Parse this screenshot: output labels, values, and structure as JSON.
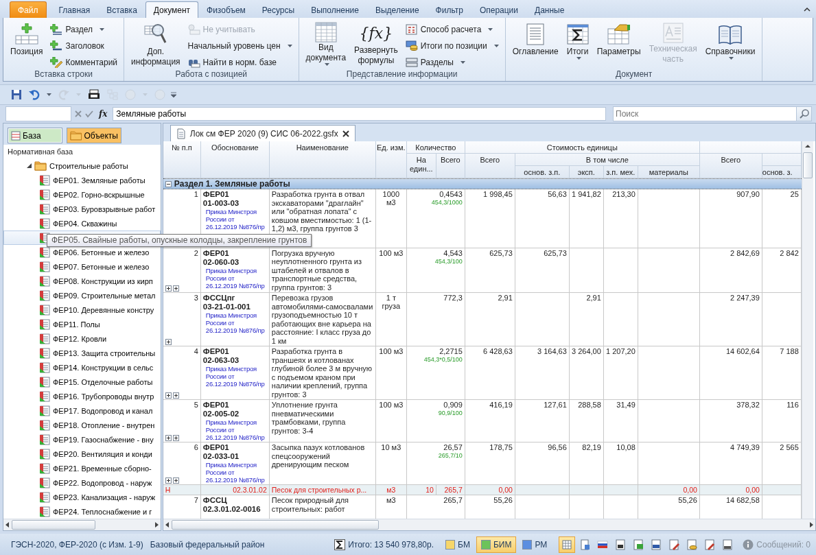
{
  "ribbon_tabs": [
    {
      "label": "Файл",
      "kind": "file",
      "selected": false
    },
    {
      "label": "Главная",
      "kind": "tab",
      "selected": false
    },
    {
      "label": "Вставка",
      "kind": "tab",
      "selected": false
    },
    {
      "label": "Документ",
      "kind": "tab",
      "selected": true
    },
    {
      "label": "Физобъем",
      "kind": "tab",
      "selected": false
    },
    {
      "label": "Ресурсы",
      "kind": "tab",
      "selected": false
    },
    {
      "label": "Выполнение",
      "kind": "tab",
      "selected": false
    },
    {
      "label": "Выделение",
      "kind": "tab",
      "selected": false
    },
    {
      "label": "Фильтр",
      "kind": "tab",
      "selected": false
    },
    {
      "label": "Операции",
      "kind": "tab",
      "selected": false
    },
    {
      "label": "Данные",
      "kind": "tab",
      "selected": false
    }
  ],
  "ribbon_groups": [
    {
      "title": "Вставка строки",
      "buttons": [
        {
          "kind": "large",
          "lines": [
            "Позиция"
          ],
          "dropdown": false,
          "disabled": false
        },
        {
          "kind": "small",
          "lines": [
            "Раздел"
          ],
          "dropdown": true,
          "disabled": false
        },
        {
          "kind": "small",
          "lines": [
            "Заголовок"
          ],
          "dropdown": false,
          "disabled": false
        },
        {
          "kind": "small",
          "lines": [
            "Комментарий"
          ],
          "dropdown": false,
          "disabled": false
        }
      ]
    },
    {
      "title": "Работа с позицией",
      "buttons": [
        {
          "kind": "large",
          "lines": [
            "Доп.",
            "информация"
          ],
          "dropdown": false,
          "disabled": false
        },
        {
          "kind": "small",
          "lines": [
            "Не учитывать"
          ],
          "dropdown": false,
          "disabled": true
        },
        {
          "kind": "small",
          "lines": [
            "Начальный уровень цен"
          ],
          "dropdown": true,
          "disabled": false
        },
        {
          "kind": "small",
          "lines": [
            "Найти в норм. базе"
          ],
          "dropdown": false,
          "disabled": false
        }
      ]
    },
    {
      "title": "Представление информации",
      "buttons": [
        {
          "kind": "large",
          "lines": [
            "Вид",
            "документа"
          ],
          "dropdown": true,
          "disabled": false
        },
        {
          "kind": "large",
          "icon_text": "{fx}",
          "lines": [
            "Развернуть",
            "формулы"
          ],
          "dropdown": false,
          "disabled": false
        },
        {
          "kind": "small",
          "lines": [
            "Способ расчета"
          ],
          "dropdown": true,
          "disabled": false
        },
        {
          "kind": "small",
          "lines": [
            "Итоги по позиции"
          ],
          "dropdown": true,
          "disabled": false
        },
        {
          "kind": "small",
          "lines": [
            "Разделы"
          ],
          "dropdown": true,
          "disabled": false
        }
      ]
    },
    {
      "title": "Документ",
      "buttons": [
        {
          "kind": "large",
          "lines": [
            "Оглавление"
          ],
          "dropdown": false,
          "disabled": false
        },
        {
          "kind": "large",
          "lines": [
            "Итоги"
          ],
          "dropdown": true,
          "disabled": false
        },
        {
          "kind": "large",
          "lines": [
            "Параметры"
          ],
          "dropdown": false,
          "disabled": false
        },
        {
          "kind": "large",
          "lines": [
            "Техническая",
            "часть"
          ],
          "dropdown": false,
          "disabled": true
        },
        {
          "kind": "large",
          "lines": [
            "Справочники"
          ],
          "dropdown": true,
          "disabled": false
        }
      ]
    }
  ],
  "quick_access": [
    {
      "disabled": false,
      "dropdown": false
    },
    {
      "disabled": false,
      "dropdown": true
    },
    {
      "disabled": true,
      "dropdown": true
    },
    {
      "disabled": false,
      "dropdown": false
    },
    {
      "disabled": true,
      "dropdown": false
    },
    {
      "disabled": true,
      "dropdown": true
    },
    {
      "disabled": true,
      "dropdown": false
    }
  ],
  "formula_bar": {
    "fx_label": "fx",
    "value": "Земляные работы"
  },
  "search": {
    "placeholder": "Поиск"
  },
  "side_tabs": [
    {
      "label": "База",
      "selected": true,
      "color": "#cde9c6"
    },
    {
      "label": "Объекты",
      "selected": false,
      "color": "#f9c062"
    }
  ],
  "tree": {
    "header": "Нормативная база",
    "items": [
      {
        "label": "Строительные работы",
        "expanded": true,
        "children": [
          {
            "label": "ФЕР01. Земляные работы",
            "selected": false
          },
          {
            "label": "ФЕР02. Горно-вскрышные",
            "selected": false
          },
          {
            "label": "ФЕР03. Буровзрывные работ",
            "selected": false
          },
          {
            "label": "ФЕР04. Скважины",
            "selected": false
          },
          {
            "selected": true
          },
          {
            "label": "ФЕР06. Бетонные и железо",
            "selected": false
          },
          {
            "label": "ФЕР07. Бетонные и железо",
            "selected": false
          },
          {
            "label": "ФЕР08. Конструкции из кирп",
            "selected": false
          },
          {
            "label": "ФЕР09. Строительные метал",
            "selected": false
          },
          {
            "label": "ФЕР10. Деревянные констру",
            "selected": false
          },
          {
            "label": "ФЕР11. Полы",
            "selected": false
          },
          {
            "label": "ФЕР12. Кровли",
            "selected": false
          },
          {
            "label": "ФЕР13. Защита строительны",
            "selected": false
          },
          {
            "label": "ФЕР14. Конструкции в сельс",
            "selected": false
          },
          {
            "label": "ФЕР15. Отделочные работы",
            "selected": false
          },
          {
            "label": "ФЕР16. Трубопроводы внутр",
            "selected": false
          },
          {
            "label": "ФЕР17. Водопровод и канал",
            "selected": false
          },
          {
            "label": "ФЕР18. Отопление - внутрен",
            "selected": false
          },
          {
            "label": "ФЕР19. Газоснабжение - вну",
            "selected": false
          },
          {
            "label": "ФЕР20. Вентиляция и конди",
            "selected": false
          },
          {
            "label": "ФЕР21. Временные сборно-",
            "selected": false
          },
          {
            "label": "ФЕР22. Водопровод - наруж",
            "selected": false
          },
          {
            "label": "ФЕР23. Канализация - наруж",
            "selected": false
          },
          {
            "label": "ФЕР24. Теплоснабжение и г",
            "selected": false
          }
        ]
      }
    ]
  },
  "tooltip": "ФЕР05. Свайные работы, опускные колодцы, закрепление грунтов",
  "document_tab": {
    "title": "Лок см ФЕР 2020 (9) СИС 06-2022.gsfx"
  },
  "table": {
    "columns": {
      "num": "№ п.п",
      "basis": "Обоснование",
      "name": "Наименование",
      "unit": "Ед. изм.",
      "quantity": "Количество",
      "quantity_per_unit": "На един...",
      "quantity_total": "Всего",
      "unit_cost": "Стоимость единицы",
      "unit_cost_total": "Всего",
      "including": "В том числе",
      "wage": "основ. з.п.",
      "machines": "эксп.",
      "mech_wage": "з.п. мех.",
      "materials": "материалы",
      "total": "Всего",
      "total_wage": "основ. з."
    },
    "rows": [
      {
        "kind": "section",
        "label": "Раздел 1. Земляные работы",
        "expanded": true
      },
      {
        "kind": "position",
        "num": "1",
        "code_prefix": "ФЕР01",
        "code": "01-003-03",
        "source": "Приказ Минстроя России от 26.12.2019 №876/пр",
        "name": "Разработка грунта в отвал экскаваторами \"драглайн\" или \"обратная лопата\" с ковшом вместимостью: 1 (1-1,2) м3, группа грунтов 3",
        "unit": "1000 м3",
        "quantity": "0,4543",
        "formula": "454,3/1000",
        "cost_total": "1 998,45",
        "cost_wage": "56,63",
        "cost_machines": "1 941,82",
        "cost_mech_wage": "213,30",
        "total": "907,90",
        "total_wage": "25"
      },
      {
        "kind": "position",
        "num": "2",
        "code_prefix": "ФЕР01",
        "code": "02-060-03",
        "source": "Приказ Минстроя России от 26.12.2019 №876/пр",
        "name": "Погрузка вручную неуплотненного грунта из штабелей и отвалов в транспортные средства, группа грунтов: 3",
        "unit": "100 м3",
        "quantity": "4,543",
        "formula": "454,3/100",
        "cost_total": "625,73",
        "cost_wage": "625,73",
        "total": "2 842,69",
        "total_wage": "2 842",
        "expanders": [
          {
            "expanded": false
          },
          {
            "expanded": false
          }
        ]
      },
      {
        "kind": "position",
        "num": "3",
        "code_prefix": "ФССЦпг",
        "code": "03-21-01-001",
        "source": "Приказ Минстроя России от 26.12.2019 №876/пр",
        "name": "Перевозка грузов автомобилями-самосвалами грузоподъемностью 10 т работающих вне карьера на расстояние: I класс груза до 1 км",
        "unit": "1 т груза",
        "quantity": "772,3",
        "cost_total": "2,91",
        "cost_machines": "2,91",
        "total": "2 247,39",
        "expanders": [
          {
            "expanded": false
          }
        ]
      },
      {
        "kind": "position",
        "num": "4",
        "code_prefix": "ФЕР01",
        "code": "02-063-03",
        "source": "Приказ Минстроя России от 26.12.2019 №876/пр",
        "name": "Разработка грунта в траншеях и котлованах глубиной более 3 м вручную с подъемом краном при наличии креплений, группа грунтов: 3",
        "unit": "100 м3",
        "quantity": "2,2715",
        "formula": "454,3*0,5/100",
        "cost_total": "6 428,63",
        "cost_wage": "3 164,63",
        "cost_machines": "3 264,00",
        "cost_mech_wage": "1 207,20",
        "total": "14 602,64",
        "total_wage": "7 188",
        "expanders": [
          {
            "expanded": false
          },
          {
            "expanded": false
          }
        ]
      },
      {
        "kind": "position",
        "num": "5",
        "code_prefix": "ФЕР01",
        "code": "02-005-02",
        "source": "Приказ Минстроя России от 26.12.2019 №876/пр",
        "name": "Уплотнение грунта пневматическими трамбовками, группа грунтов: 3-4",
        "unit": "100 м3",
        "quantity": "0,909",
        "formula": "90,9/100",
        "cost_total": "416,19",
        "cost_wage": "127,61",
        "cost_machines": "288,58",
        "cost_mech_wage": "31,49",
        "total": "378,32",
        "total_wage": "116",
        "expanders": [
          {
            "expanded": false
          },
          {
            "expanded": false
          }
        ]
      },
      {
        "kind": "position",
        "num": "6",
        "code_prefix": "ФЕР01",
        "code": "02-033-01",
        "source": "Приказ Минстроя России от 26.12.2019 №876/пр",
        "name": "Засыпка пазух котлованов спецсооружений дренирующим песком",
        "unit": "10 м3",
        "quantity": "26,57",
        "formula": "265,7/10",
        "cost_total": "178,75",
        "cost_wage": "96,56",
        "cost_machines": "82,19",
        "cost_mech_wage": "10,08",
        "total": "4 749,39",
        "total_wage": "2 565",
        "expanders": [
          {
            "expanded": false
          },
          {
            "expanded": false
          }
        ]
      },
      {
        "kind": "resource",
        "marker": "Н",
        "code": "02.3.01.02",
        "name": "Песок для строительных р...",
        "unit": "м3",
        "quantity_per_unit": "10",
        "quantity": "265,7",
        "cost_total": "0,00",
        "cost_materials": "0,00",
        "total": "0,00"
      },
      {
        "kind": "position",
        "num": "7",
        "code_prefix": "ФССЦ",
        "code": "02.3.01.02-0016",
        "name": "Песок природный для строительных: работ",
        "unit": "м3",
        "quantity": "265,7",
        "cost_total": "55,26",
        "cost_materials": "55,26",
        "total": "14 682,58"
      }
    ]
  },
  "status_bar": {
    "base": "ГЭСН-2020, ФЕР-2020 (с Изм. 1-9)",
    "region": "Базовый федеральный район",
    "total": "Итого: 13 540 978,80р.",
    "price_modes": [
      {
        "label": "БМ",
        "selected": false,
        "color": "#f6d66b"
      },
      {
        "label": "БИМ",
        "selected": true,
        "color": "#6cc35a"
      },
      {
        "label": "РМ",
        "selected": false,
        "color": "#5b8ee0"
      }
    ],
    "view_buttons": [
      {
        "selected": true
      },
      {
        "selected": false
      },
      {
        "selected": false
      },
      {
        "selected": false
      },
      {
        "selected": false
      },
      {
        "selected": false
      },
      {
        "selected": false
      },
      {
        "selected": false
      },
      {
        "selected": false
      },
      {
        "selected": false
      }
    ],
    "messages": "Сообщений: 0"
  }
}
